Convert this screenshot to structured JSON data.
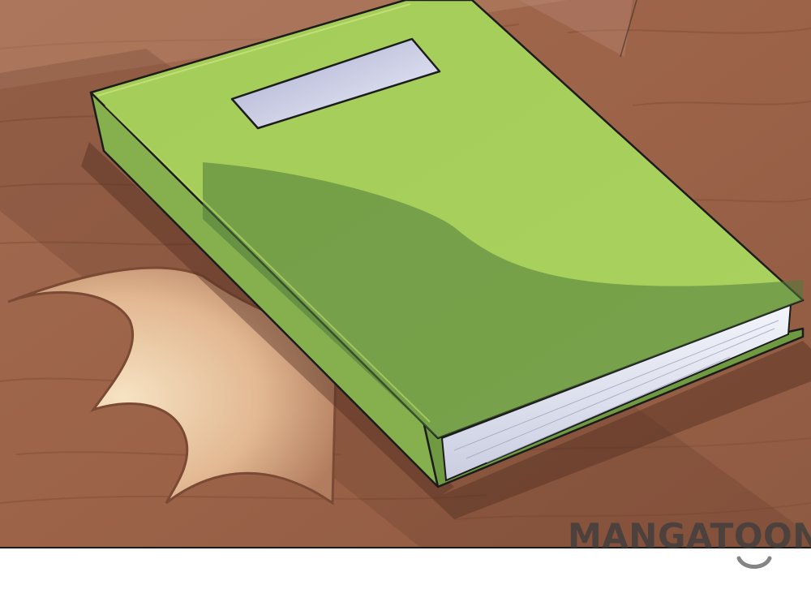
{
  "watermark": {
    "text": "MANGATOON"
  },
  "scene": {
    "subject": "green-hardcover-book",
    "surface": "wooden-table",
    "colors": {
      "wood": "#a0684e",
      "wood_dark": "#7e4e38",
      "wood_light_patch": "#f1d8b4",
      "book_cover": "#a3cb57",
      "book_cover_shadow": "#5f8a43",
      "book_spine": "#7aa648",
      "book_pages": "#e8ecf5",
      "cover_label": "#d7d9ec",
      "outline": "#1c1c1c",
      "page_background": "#ffffff"
    }
  }
}
